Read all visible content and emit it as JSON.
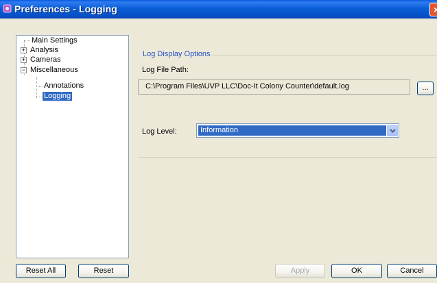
{
  "window": {
    "title": "Preferences - Logging",
    "close_glyph": "×"
  },
  "tree": {
    "items": [
      {
        "label": "Main Settings",
        "toggle": ""
      },
      {
        "label": "Analysis",
        "toggle": "+"
      },
      {
        "label": "Cameras",
        "toggle": "+"
      },
      {
        "label": "Miscellaneous",
        "toggle": "−"
      },
      {
        "label": "Annotations",
        "toggle": ""
      },
      {
        "label": "Logging",
        "toggle": "",
        "selected": true
      }
    ]
  },
  "left_buttons": {
    "reset_all": "Reset All",
    "reset": "Reset"
  },
  "log_display": {
    "group_title": "Log Display Options",
    "path_label": "Log File Path:",
    "path_value": "C:\\Program Files\\UVP LLC\\Doc-It Colony Counter\\default.log",
    "browse_label": "...",
    "level_label": "Log Level:",
    "level_value": "Information"
  },
  "dialog_buttons": {
    "apply": "Apply",
    "ok": "OK",
    "cancel": "Cancel"
  },
  "colors": {
    "titlebar": "#0A5FD8",
    "selection": "#316AC5",
    "group_title": "#2452C6",
    "window_bg": "#ECE9D8"
  },
  "icons": {
    "app": "app-icon",
    "close": "close-icon",
    "dropdown": "chevron-down-icon"
  }
}
